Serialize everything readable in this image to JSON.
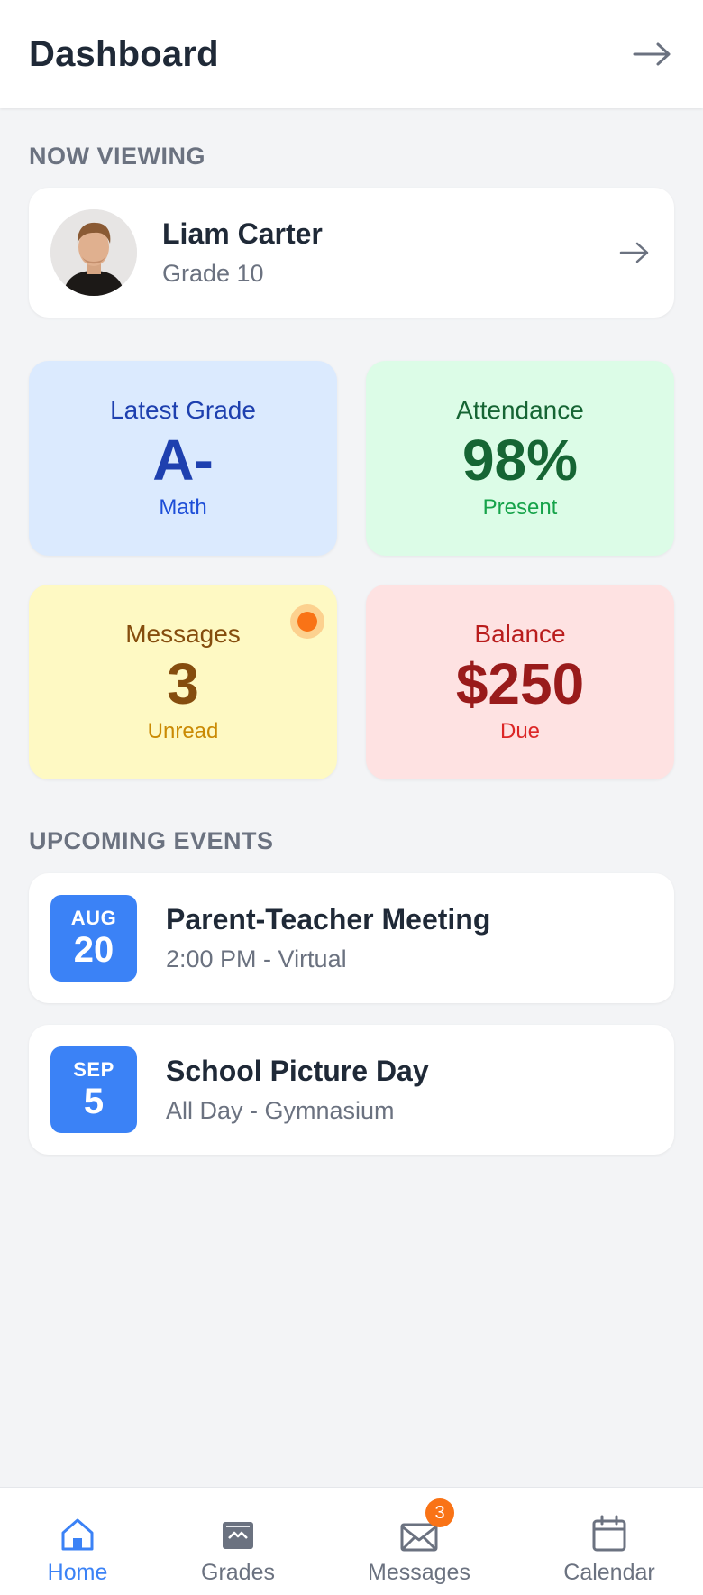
{
  "header": {
    "title": "Dashboard"
  },
  "now_viewing": {
    "label": "NOW VIEWING",
    "child": {
      "name": "Liam Carter",
      "grade": "Grade 10"
    }
  },
  "stats": {
    "latest_grade": {
      "label": "Latest Grade",
      "value": "A-",
      "sub": "Math",
      "bg": "#dbeafe",
      "fg": "#1e40af",
      "accent": "#1d4ed8"
    },
    "attendance": {
      "label": "Attendance",
      "value": "98%",
      "sub": "Present",
      "bg": "#dcfce7",
      "fg": "#166534",
      "accent": "#16a34a"
    },
    "messages": {
      "label": "Messages",
      "value": "3",
      "sub": "Unread",
      "bg": "#fef9c3",
      "fg": "#854d0e",
      "accent": "#ca8a04"
    },
    "balance": {
      "label": "Balance",
      "value": "$250",
      "sub": "Due",
      "bg": "#fee2e2",
      "fg": "#991b1b",
      "accent": "#dc2626"
    }
  },
  "upcoming": {
    "label": "UPCOMING EVENTS",
    "events": [
      {
        "month": "AUG",
        "day": "20",
        "title": "Parent-Teacher Meeting",
        "sub": "2:00 PM - Virtual"
      },
      {
        "month": "SEP",
        "day": "5",
        "title": "School Picture Day",
        "sub": "All Day - Gymnasium"
      }
    ]
  },
  "nav": {
    "items": [
      {
        "label": "Home",
        "icon": "home-icon",
        "active": true
      },
      {
        "label": "Grades",
        "icon": "grades-icon",
        "active": false
      },
      {
        "label": "Messages",
        "icon": "mail-icon",
        "active": false,
        "badge": "3"
      },
      {
        "label": "Calendar",
        "icon": "calendar-icon",
        "active": false
      }
    ]
  },
  "colors": {
    "accent": "#3b82f6",
    "badge": "#f97316"
  }
}
